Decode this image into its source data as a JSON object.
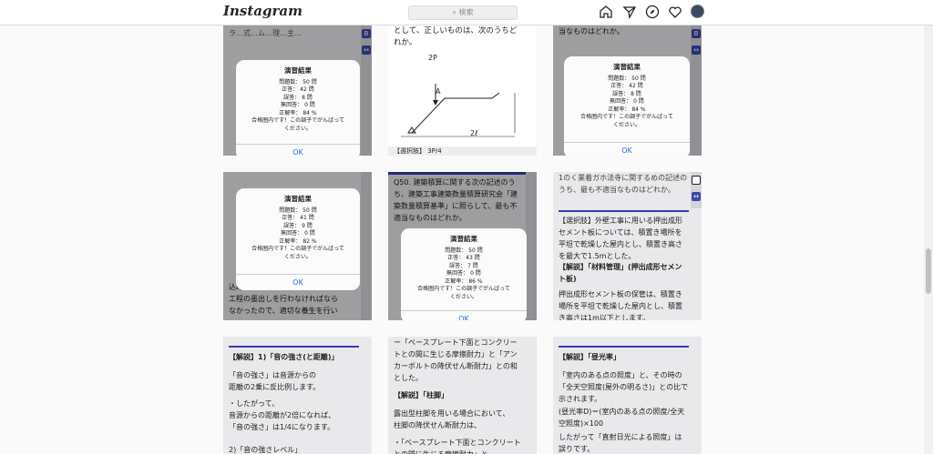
{
  "app": {
    "logo": "Instagram",
    "search_placeholder": "検索"
  },
  "dialog": {
    "title": "演習結果",
    "ok": "OK",
    "msg1": "合格圏内です！この調子でがんばって",
    "msg2": "ください。"
  },
  "results": [
    {
      "l1": "問題数： 50 問",
      "l2": "正答： 42 問",
      "l3": "誤答： 8 問",
      "l4": "無回答： 0 問",
      "l5": "正解率： 84 %"
    },
    {
      "l1": "問題数： 50 問",
      "l2": "正答： 42 問",
      "l3": "誤答： 8 問",
      "l4": "無回答： 0 問",
      "l5": "正解率： 84 %"
    },
    {
      "l1": "問題数： 50 問",
      "l2": "正答： 41 問",
      "l3": "誤答： 9 問",
      "l4": "無回答： 0 問",
      "l5": "正解率： 82 %"
    },
    {
      "l1": "問題数： 50 問",
      "l2": "正答： 43 問",
      "l3": "誤答： 7 問",
      "l4": "無回答： 0 問",
      "l5": "正解率： 86 %"
    }
  ],
  "t2": {
    "q": "として、正しいものは、次のうちどれか。",
    "p2": "2P",
    "a": "A",
    "l": "2ℓ",
    "sel": "【選択肢】 3P/4"
  },
  "t3": {
    "q": "当なものはどれか。"
  },
  "t5": {
    "q": "Q50. 建築積算に関する次の記述のうち、建築工事建築数量積算研究会「建築数量積算基準」に照らして、最も不適当なものはどれか。"
  },
  "t6": {
    "top": "1のく業着ガホ法寺に関するめの記述の うち、最も不適当なものはどれか。",
    "sel": "【選択肢】外壁工事に用いる押出成形セメント板については、積置き場所を平坦で乾燥した屋内とし、積置き高さを最大で1.5mとした。",
    "exp": "【解説】「材料管理」(押出成形セメント板)",
    "ans": "押出成形セメント板の保管は、積置き場所を平坦で乾燥した屋内とし、積置き高さは1m以下とします。"
  },
  "t4": {
    "b1": "込みをした翌日に、やむを得ず次",
    "b2": "工程の墨出しを行わなければなら",
    "b3": "なかったので、適切な養生を行い"
  },
  "t7": {
    "h": "【解説】1)「音の強さ(と距離)」",
    "p1": "「音の強さ」は音源からの",
    "p2": "距離の2乗に反比例します。",
    "p3": "・したがって、",
    "p4": "音源からの距離が2倍になれば、",
    "p5": "「音の強さ」は1/4になります。",
    "p6": "2)「音の強さレベル」"
  },
  "t8": {
    "p1": "ー「ベースプレート下面とコンクリー",
    "p2": "トとの間に生じる摩擦耐力」と「アンカーボルトの降伏せん断耐力」との和とした。",
    "h": "【解説】「柱脚」",
    "p3": "露出型柱脚を用いる場合において、",
    "p4": "柱脚の降伏せん断耐力は、",
    "p5": "・「ベースプレート下面とコンクリートとの間に生じる摩擦耐力」と"
  },
  "t9": {
    "h": "【解説】「昼光率」",
    "p1": "「室内のある点の照度」と、その時の「全天空照度(屋外の明るさ)」との比で示されます。",
    "p2": "(昼光率D)＝(室内のある点の照度/全天空照度)×100",
    "p3": "したがって「直射日光による照度」は誤りです。"
  }
}
